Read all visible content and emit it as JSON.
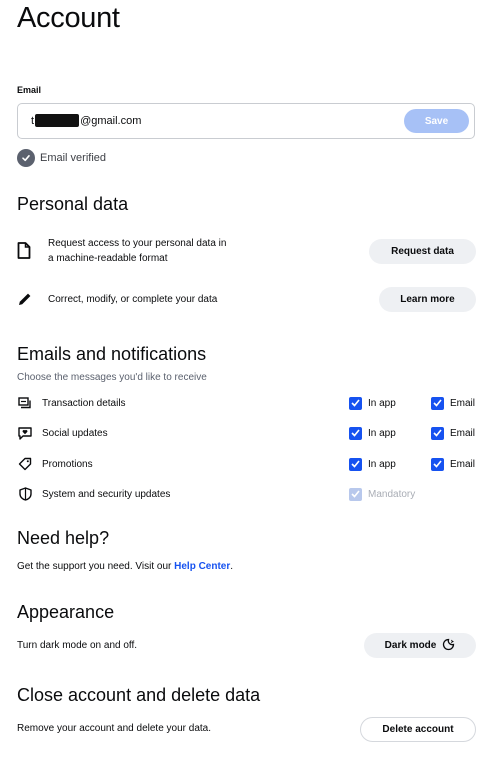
{
  "page": {
    "title": "Account"
  },
  "email": {
    "label": "Email",
    "value_start": "t",
    "value_end": "@gmail.com",
    "save_label": "Save",
    "verified_text": "Email verified"
  },
  "personal_data": {
    "heading": "Personal data",
    "items": [
      {
        "text_line1": "Request access to your personal data in",
        "text_line2": "a machine-readable format",
        "button": "Request data",
        "icon": "document-icon"
      },
      {
        "text_line1": "Correct, modify, or complete your data",
        "button": "Learn more",
        "icon": "pencil-icon"
      }
    ]
  },
  "notifications": {
    "heading": "Emails and notifications",
    "subtitle": "Choose the messages you'd like to receive",
    "rows": [
      {
        "label": "Transaction details",
        "in_app": "In app",
        "email": "Email",
        "icon": "receipt-icon"
      },
      {
        "label": "Social updates",
        "in_app": "In app",
        "email": "Email",
        "icon": "chat-heart-icon"
      },
      {
        "label": "Promotions",
        "in_app": "In app",
        "email": "Email",
        "icon": "tag-icon"
      },
      {
        "label": "System and security updates",
        "mandatory": "Mandatory",
        "icon": "shield-icon"
      }
    ]
  },
  "help": {
    "heading": "Need help?",
    "text": "Get the support you need. Visit our ",
    "link": "Help Center",
    "period": "."
  },
  "appearance": {
    "heading": "Appearance",
    "text": "Turn dark mode on and off.",
    "button": "Dark mode"
  },
  "close_account": {
    "heading": "Close account and delete data",
    "text": "Remove your account and delete your data.",
    "button": "Delete account"
  },
  "colors": {
    "accent": "#1652f0",
    "save_disabled": "#a7c1f6"
  }
}
